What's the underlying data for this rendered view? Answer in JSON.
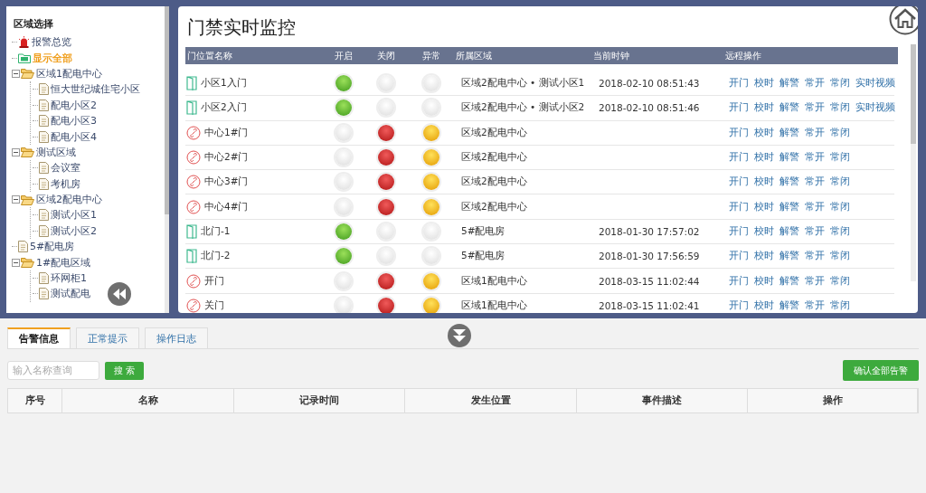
{
  "sidebar": {
    "title": "区域选择",
    "tree": [
      {
        "label": "报警总览",
        "kind": "alarm"
      },
      {
        "label": "显示全部",
        "kind": "all"
      },
      {
        "label": "区域1配电中心",
        "kind": "folder",
        "expanded": true,
        "children": [
          {
            "label": "恒大世纪城住宅小区",
            "kind": "file"
          },
          {
            "label": "配电小区2",
            "kind": "file"
          },
          {
            "label": "配电小区3",
            "kind": "file"
          },
          {
            "label": "配电小区4",
            "kind": "file"
          }
        ]
      },
      {
        "label": "测试区域",
        "kind": "folder",
        "expanded": true,
        "children": [
          {
            "label": "会议室",
            "kind": "file"
          },
          {
            "label": "考机房",
            "kind": "file"
          }
        ]
      },
      {
        "label": "区域2配电中心",
        "kind": "folder",
        "expanded": true,
        "children": [
          {
            "label": "测试小区1",
            "kind": "file"
          },
          {
            "label": "测试小区2",
            "kind": "file"
          }
        ]
      },
      {
        "label": "5#配电房",
        "kind": "file"
      },
      {
        "label": "1#配电区域",
        "kind": "folder",
        "expanded": true,
        "children": [
          {
            "label": "环网柜1",
            "kind": "file"
          },
          {
            "label": "测试配电",
            "kind": "file"
          }
        ]
      }
    ]
  },
  "monitor": {
    "title": "门禁实时监控",
    "columns": [
      "门位置名称",
      "开启",
      "关闭",
      "异常",
      "所属区域",
      "当前时钟",
      "远程操作"
    ],
    "rows": [
      {
        "kind": "online",
        "name": "小区1入门",
        "open": true,
        "closed": false,
        "abnormal": false,
        "region": "区域2配电中心 • 测试小区1",
        "time": "2018-02-10 08:51:43",
        "actions": [
          "开门",
          "校时",
          "解警",
          "常开",
          "常闭",
          "实时视频"
        ]
      },
      {
        "kind": "online",
        "name": "小区2入门",
        "open": true,
        "closed": false,
        "abnormal": false,
        "region": "区域2配电中心 • 测试小区2",
        "time": "2018-02-10 08:51:46",
        "actions": [
          "开门",
          "校时",
          "解警",
          "常开",
          "常闭",
          "实时视频"
        ]
      },
      {
        "kind": "offline",
        "name": "中心1#门",
        "open": false,
        "closed": true,
        "abnormal": true,
        "region": "区域2配电中心",
        "actions": [
          "开门",
          "校时",
          "解警",
          "常开",
          "常闭"
        ]
      },
      {
        "kind": "offline",
        "name": "中心2#门",
        "open": false,
        "closed": true,
        "abnormal": true,
        "region": "区域2配电中心",
        "actions": [
          "开门",
          "校时",
          "解警",
          "常开",
          "常闭"
        ]
      },
      {
        "kind": "offline",
        "name": "中心3#门",
        "open": false,
        "closed": true,
        "abnormal": true,
        "region": "区域2配电中心",
        "actions": [
          "开门",
          "校时",
          "解警",
          "常开",
          "常闭"
        ]
      },
      {
        "kind": "offline",
        "name": "中心4#门",
        "open": false,
        "closed": true,
        "abnormal": true,
        "region": "区域2配电中心",
        "actions": [
          "开门",
          "校时",
          "解警",
          "常开",
          "常闭"
        ]
      },
      {
        "kind": "online",
        "name": "北门-1",
        "open": true,
        "closed": false,
        "abnormal": false,
        "region": "5#配电房",
        "time": "2018-01-30 17:57:02",
        "actions": [
          "开门",
          "校时",
          "解警",
          "常开",
          "常闭"
        ]
      },
      {
        "kind": "online",
        "name": "北门-2",
        "open": true,
        "closed": false,
        "abnormal": false,
        "region": "5#配电房",
        "time": "2018-01-30 17:56:59",
        "actions": [
          "开门",
          "校时",
          "解警",
          "常开",
          "常闭"
        ]
      },
      {
        "kind": "offline",
        "name": "开门",
        "open": false,
        "closed": true,
        "abnormal": true,
        "region": "区域1配电中心",
        "time": "2018-03-15 11:02:44",
        "actions": [
          "开门",
          "校时",
          "解警",
          "常开",
          "常闭"
        ]
      },
      {
        "kind": "offline",
        "name": "关门",
        "open": false,
        "closed": true,
        "abnormal": true,
        "region": "区域1配电中心",
        "time": "2018-03-15 11:02:41",
        "actions": [
          "开门",
          "校时",
          "解警",
          "常开",
          "常闭"
        ]
      }
    ]
  },
  "bottom": {
    "tabs": [
      {
        "label": "告警信息",
        "selected": true
      },
      {
        "label": "正常提示",
        "selected": false
      },
      {
        "label": "操作日志",
        "selected": false
      }
    ],
    "search": {
      "placeholder": "输入名称查询"
    },
    "search_button": "搜 索",
    "confirm_button": "确认全部告警",
    "columns": [
      "序号",
      "名称",
      "记录时间",
      "发生位置",
      "事件描述",
      "操作"
    ]
  }
}
